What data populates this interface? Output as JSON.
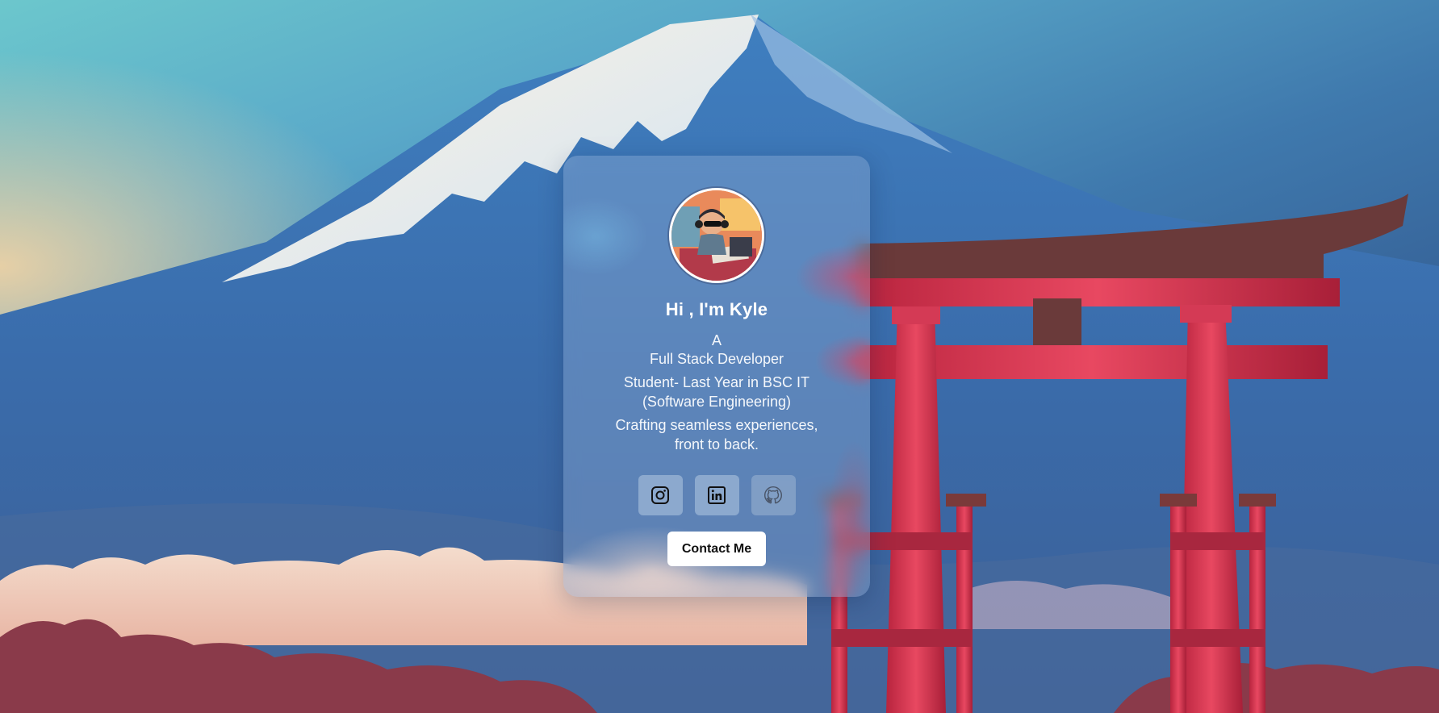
{
  "profile": {
    "greeting": "Hi , I'm Kyle",
    "role_prefix": "A",
    "role": "Full Stack Developer",
    "education_line1": "Student- Last Year in BSC IT",
    "education_line2": "(Software Engineering)",
    "tagline_line1": "Crafting seamless experiences,",
    "tagline_line2": "front to back."
  },
  "socials": [
    {
      "name": "Instagram",
      "icon": "instagram-icon"
    },
    {
      "name": "LinkedIn",
      "icon": "linkedin-icon"
    },
    {
      "name": "GitHub",
      "icon": "github-icon"
    }
  ],
  "contact": {
    "button_label": "Contact Me"
  },
  "colors": {
    "torii_red": "#e03a55",
    "sky_teal": "#6cc7cc",
    "button_bg": "#ffffff"
  }
}
